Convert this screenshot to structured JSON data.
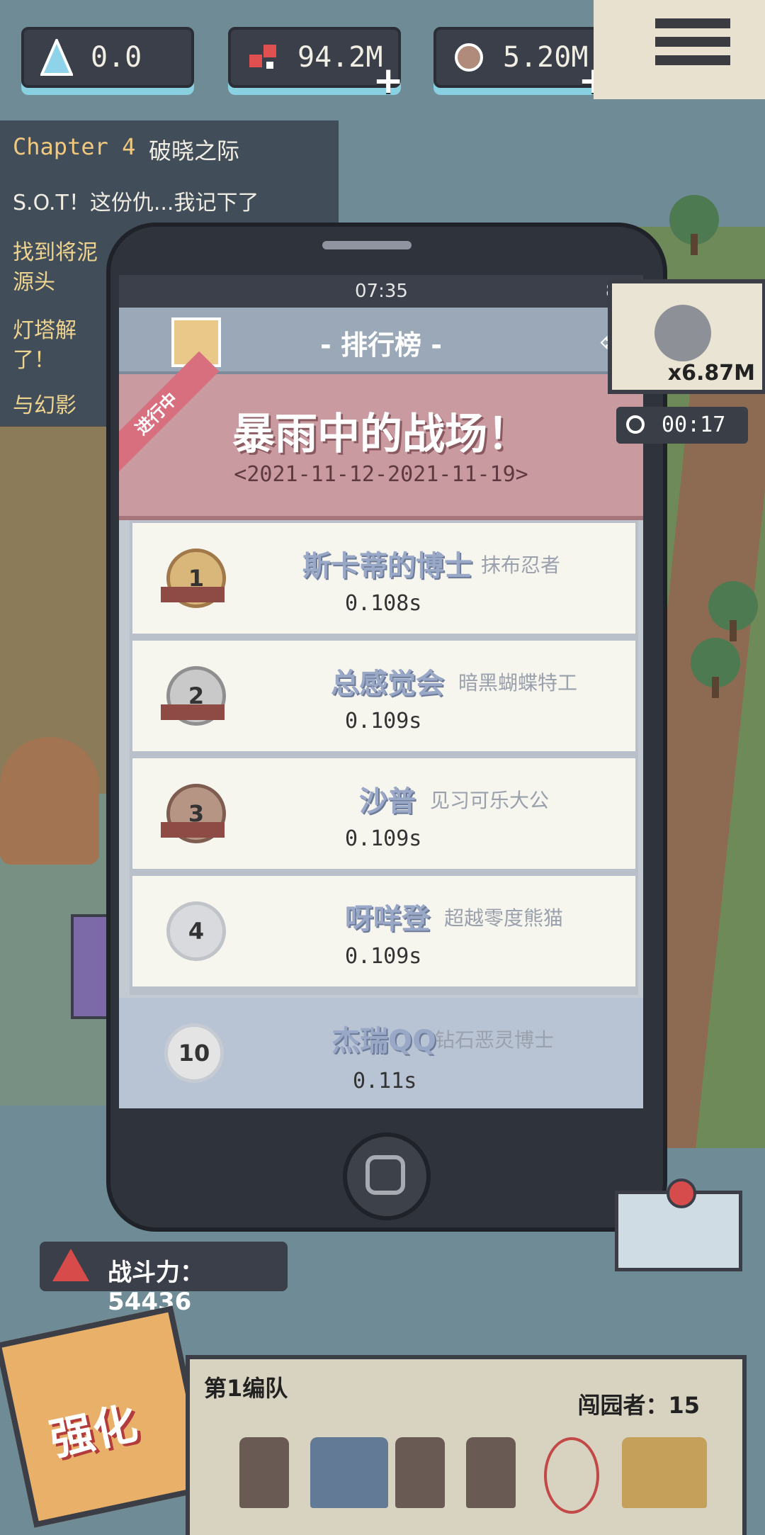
{
  "resources": {
    "crystal": "0.0",
    "parts": "94.2M",
    "ore": "5.20M"
  },
  "quest": {
    "chapter": "Chapter 4",
    "title": "破晓之际",
    "lines": [
      "S.O.T！这份仇...我记下了",
      "找到将泥",
      "源头",
      "灯塔解",
      "了！",
      "与幻影"
    ]
  },
  "phone": {
    "time": "07:35",
    "battery": "88",
    "header_title": "- 排行榜 -",
    "event": {
      "badge": "进行中",
      "title": "暴雨中的战场！",
      "dates": "<2021-11-12-2021-11-19>"
    },
    "ranks": [
      {
        "rank": "1",
        "name": "斯卡蒂的博士",
        "title": "抹布忍者",
        "time": "0.108s"
      },
      {
        "rank": "2",
        "name": "总感觉会",
        "title": "暗黑蝴蝶特工",
        "time": "0.109s"
      },
      {
        "rank": "3",
        "name": "沙普",
        "title": "见习可乐大公",
        "time": "0.109s"
      },
      {
        "rank": "4",
        "name": "呀咩登",
        "title": "超越零度熊猫",
        "time": "0.109s"
      }
    ],
    "self": {
      "rank": "10",
      "name": "杰瑞QQ",
      "title": "钻石恶灵博士",
      "time": "0.11s"
    }
  },
  "boost": {
    "value": "x6.87M",
    "timer": "00:17"
  },
  "power": {
    "label": "战斗力：54436"
  },
  "upgrade": {
    "label": "强化"
  },
  "team": {
    "name": "第1编队",
    "count": "闯园者：15"
  }
}
